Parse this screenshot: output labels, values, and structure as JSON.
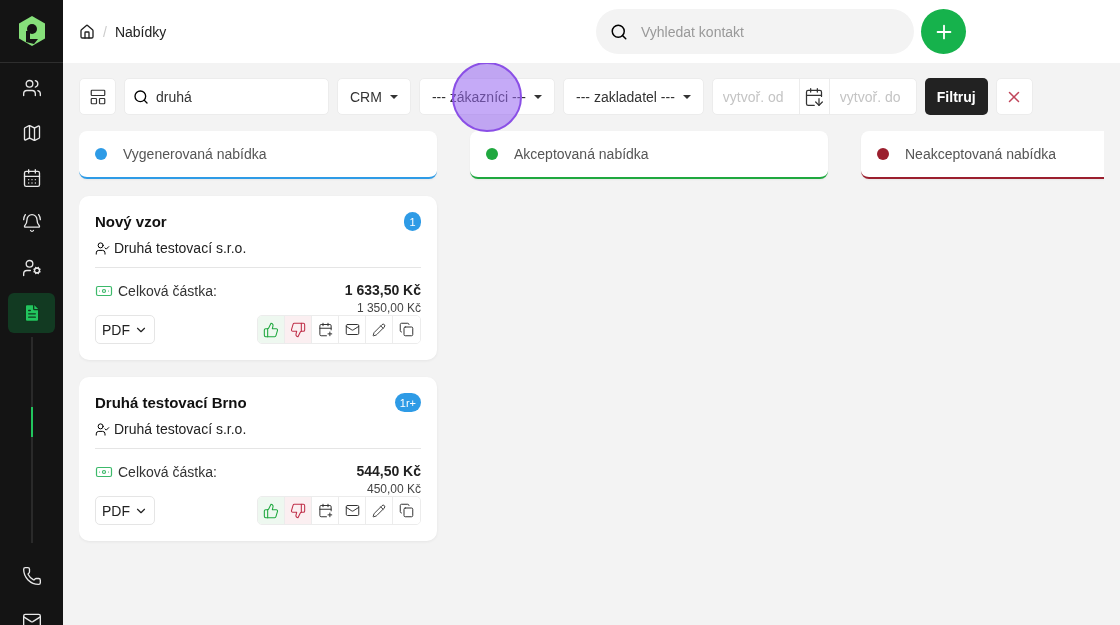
{
  "sidebar": {
    "items": [
      {
        "kind": "contacts",
        "selected": false
      },
      {
        "kind": "map",
        "selected": false
      },
      {
        "kind": "calendar",
        "selected": false
      },
      {
        "kind": "alarm",
        "selected": false
      },
      {
        "kind": "user-key",
        "selected": false
      },
      {
        "kind": "offers",
        "selected": true
      },
      {
        "kind": "phone",
        "selected": false
      },
      {
        "kind": "mail",
        "selected": false
      }
    ]
  },
  "breadcrumb": {
    "separator": "/",
    "items": [
      "Nabídky"
    ]
  },
  "header_search": {
    "placeholder": "Vyhledat kontakt"
  },
  "filters": [
    {
      "kind": "view-toggle"
    },
    {
      "kind": "search",
      "value": "druhá"
    },
    {
      "kind": "select",
      "value": "CRM",
      "highlighted": false
    },
    {
      "kind": "select",
      "value": "--- zákazníci ---",
      "highlighted": true
    },
    {
      "kind": "select",
      "value": "--- zakladatel ---",
      "highlighted": false
    },
    {
      "kind": "daterange",
      "from_placeholder": "vytvoř. od",
      "to_placeholder": "vytvoř. do"
    },
    {
      "kind": "submit",
      "label": "Filtruj"
    },
    {
      "kind": "clear"
    }
  ],
  "columns": [
    {
      "title": "Vygenerovaná nabídka",
      "color": "#2e9be6",
      "cards": [
        {
          "title": "Nový vzor",
          "badge": "1",
          "customer": "Druhá testovací s.r.o.",
          "total_label": "Celková částka:",
          "total": "1 633,50 Kč",
          "subtotal": "1 350,00 Kč",
          "export": "PDF"
        },
        {
          "title": "Druhá testovací Brno",
          "badge": "1r+",
          "customer": "Druhá testovací s.r.o.",
          "total_label": "Celková částka:",
          "total": "544,50 Kč",
          "subtotal": "450,00 Kč",
          "export": "PDF"
        }
      ]
    },
    {
      "title": "Akceptovaná nabídka",
      "color": "#1fa83f"
    },
    {
      "title": "Neakceptovaná nabídka",
      "color": "#9b1f2e"
    }
  ]
}
